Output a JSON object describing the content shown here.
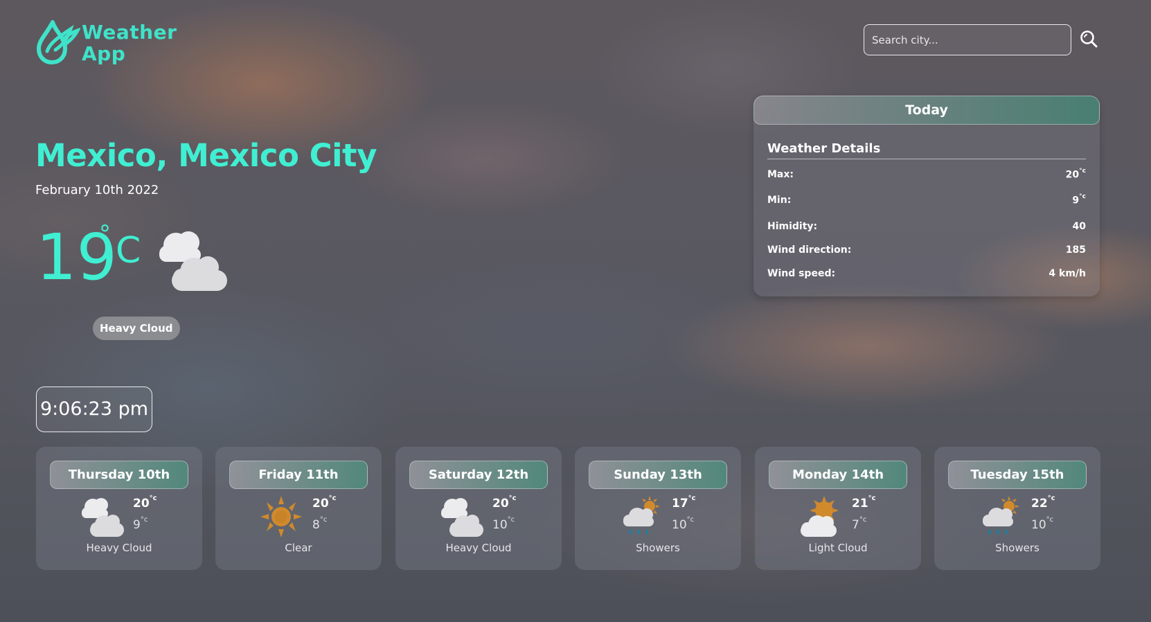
{
  "app": {
    "logo_line1": "Weather",
    "logo_line2": "App"
  },
  "search": {
    "placeholder": "Search city..."
  },
  "location": {
    "title": "Mexico, Mexico City",
    "date": "February 10th 2022"
  },
  "current": {
    "temp": "19",
    "deg": "°",
    "unit": "C",
    "condition": "Heavy Cloud",
    "icon": "heavy-cloud-icon"
  },
  "clock": {
    "time": "9:06:23 pm"
  },
  "today": {
    "heading": "Today",
    "subheading": "Weather Details",
    "rows": [
      {
        "label": "Max:",
        "value": "20",
        "unit": "°c"
      },
      {
        "label": "Min:",
        "value": "9",
        "unit": "°c"
      },
      {
        "label": "Himidity:",
        "value": "40",
        "unit": ""
      },
      {
        "label": "Wind direction:",
        "value": "185",
        "unit": ""
      },
      {
        "label": "Wind speed:",
        "value": "4 km/h",
        "unit": ""
      }
    ]
  },
  "forecast": [
    {
      "day": "Thursday 10th",
      "max": "20",
      "min": "9",
      "unit": "°c",
      "condition": "Heavy Cloud",
      "icon": "heavy-cloud-icon"
    },
    {
      "day": "Friday 11th",
      "max": "20",
      "min": "8",
      "unit": "°c",
      "condition": "Clear",
      "icon": "sun-icon"
    },
    {
      "day": "Saturday 12th",
      "max": "20",
      "min": "10",
      "unit": "°c",
      "condition": "Heavy Cloud",
      "icon": "heavy-cloud-icon"
    },
    {
      "day": "Sunday 13th",
      "max": "17",
      "min": "10",
      "unit": "°c",
      "condition": "Showers",
      "icon": "showers-icon"
    },
    {
      "day": "Monday 14th",
      "max": "21",
      "min": "7",
      "unit": "°c",
      "condition": "Light Cloud",
      "icon": "light-cloud-icon"
    },
    {
      "day": "Tuesday 15th",
      "max": "22",
      "min": "10",
      "unit": "°c",
      "condition": "Showers",
      "icon": "showers-icon"
    }
  ],
  "colors": {
    "accent": "#40efd2",
    "logo": "#3fe3c9",
    "sun": "#d08a2c",
    "rain": "#1f7fa0",
    "cloud": "#e8e8ea"
  }
}
